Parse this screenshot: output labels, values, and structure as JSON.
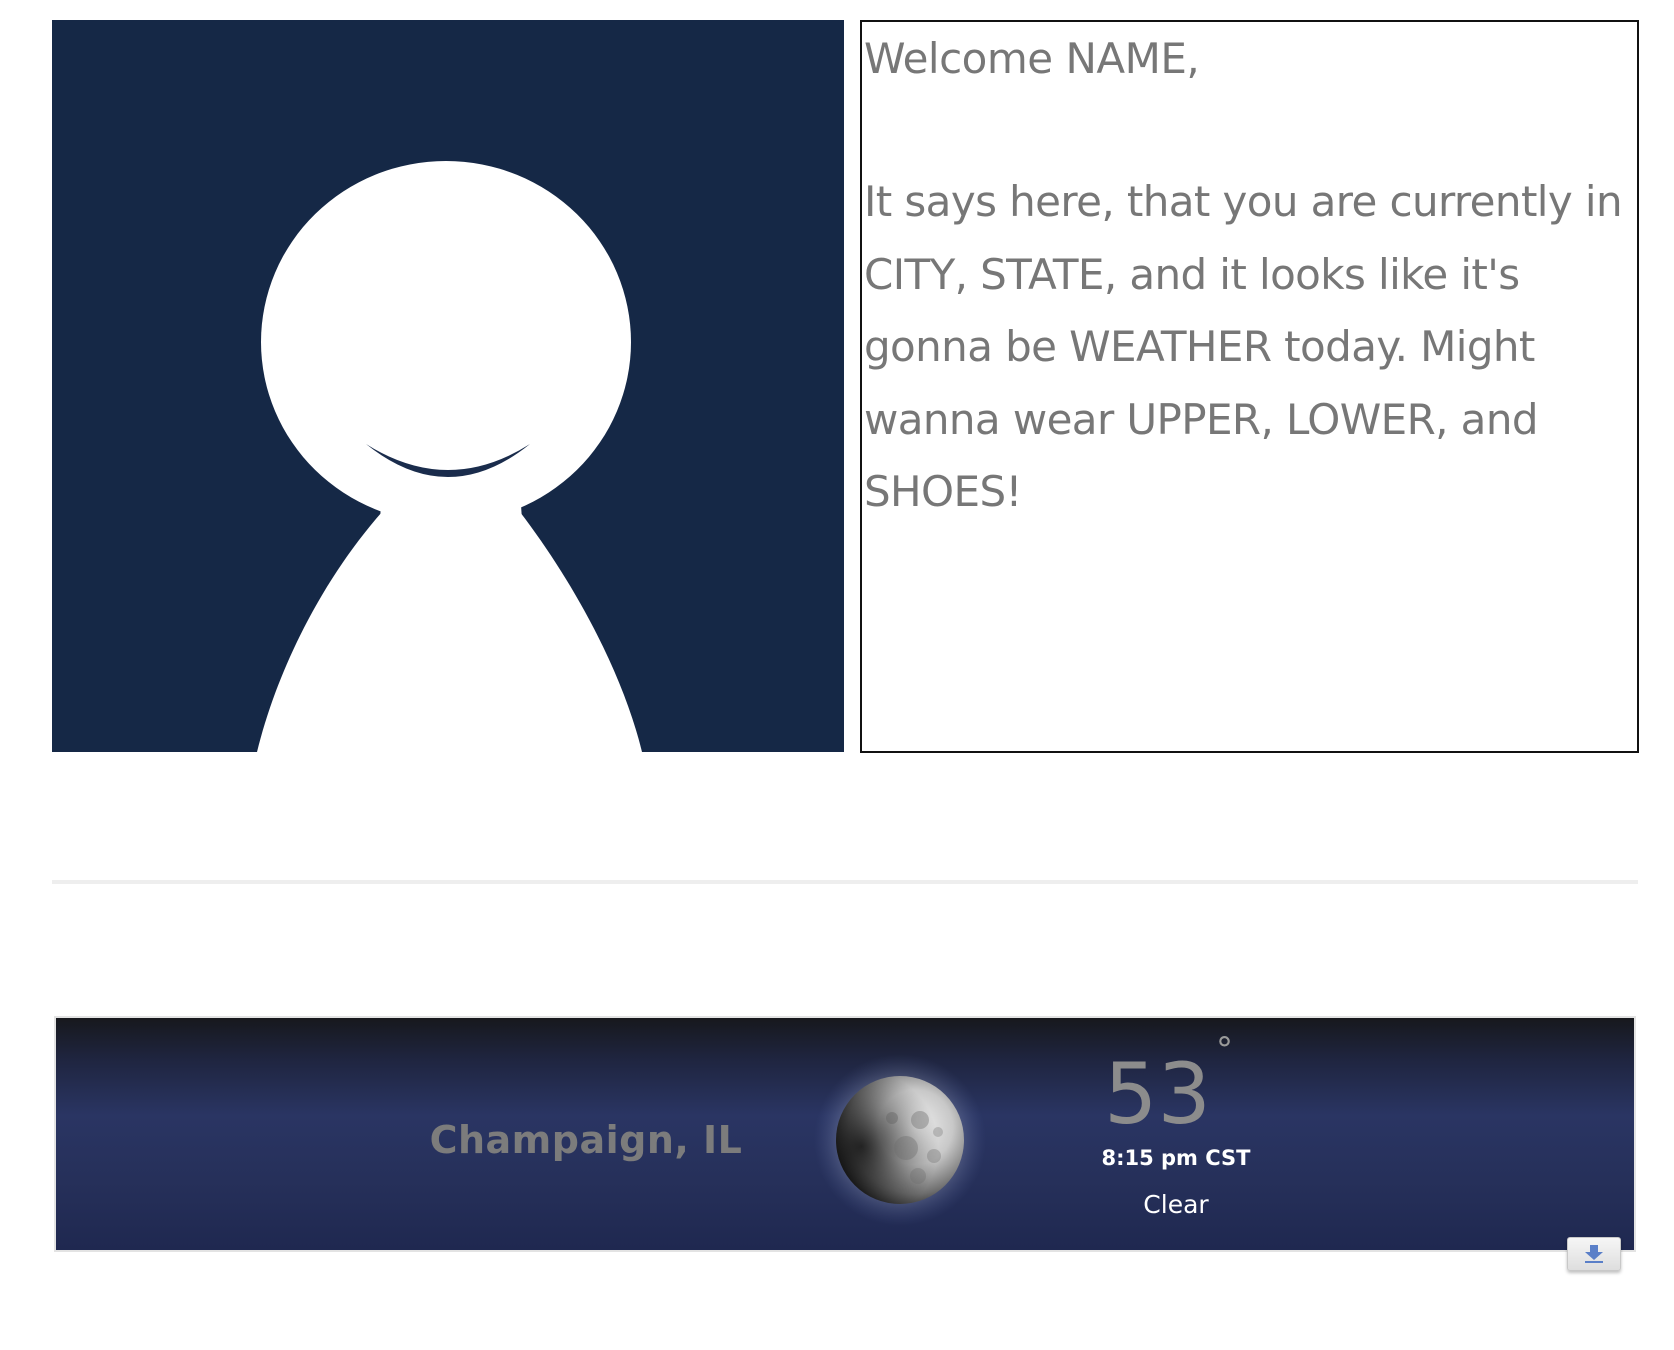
{
  "welcome": {
    "title": "Welcome NAME,",
    "message": "It says here, that you are currently in CITY, STATE, and it looks like it's gonna be WEATHER today. Might wanna wear UPPER, LOWER, and SHOES!"
  },
  "avatar": {
    "icon": "user-silhouette-icon",
    "background_color": "#152846"
  },
  "weather": {
    "location": "Champaign, IL",
    "temperature": "53",
    "degree_symbol": "°",
    "time": "8:15 pm CST",
    "condition": "Clear",
    "icon": "moon-icon",
    "download_icon": "download-arrow-icon"
  }
}
